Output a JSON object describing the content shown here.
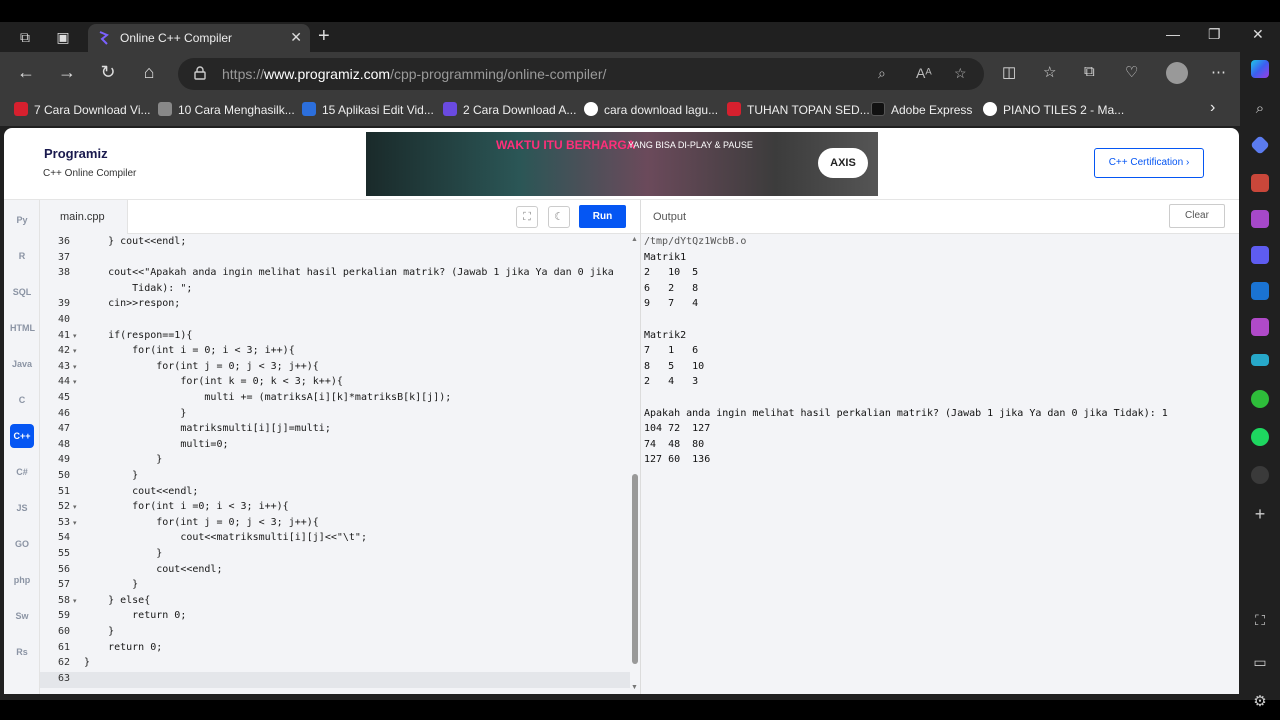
{
  "browser": {
    "tab_title": "Online C++ Compiler",
    "url_prefix": "https://",
    "url_domain": "www.programiz.com",
    "url_path": "/cpp-programming/online-compiler/",
    "bookmarks": [
      {
        "label": "7 Cara Download Vi...",
        "color": "#d6202e"
      },
      {
        "label": "10 Cara Menghasilk...",
        "color": "#666666"
      },
      {
        "label": "15 Aplikasi Edit Vid...",
        "color": "#2c6fdc"
      },
      {
        "label": "2 Cara Download A...",
        "color": "#6a4ae0"
      },
      {
        "label": "cara download lagu...",
        "color": "#ffffff"
      },
      {
        "label": "TUHAN TOPAN SED...",
        "color": "#d6202e"
      },
      {
        "label": "Adobe Express",
        "color": "#111111"
      },
      {
        "label": "PIANO TILES 2 - Ma...",
        "color": "#ffffff"
      }
    ]
  },
  "header": {
    "logo": "Programiz",
    "subtitle": "C++ Online Compiler",
    "ad_text": "WAKTU ITU BERHARGA",
    "ad_text2": "YANG BISA DI-PLAY & PAUSE",
    "ad_brand": "AXIS",
    "cert_button": "C++ Certification ›"
  },
  "languages": [
    "Py",
    "R",
    "SQL",
    "HTML",
    "Java",
    "C",
    "C++",
    "C#",
    "JS",
    "GO",
    "php",
    "Sw",
    "Rs"
  ],
  "editor": {
    "filename": "main.cpp",
    "run_label": "Run",
    "lines": [
      {
        "n": "36",
        "f": "",
        "t": "    } cout<<endl;"
      },
      {
        "n": "37",
        "f": "",
        "t": ""
      },
      {
        "n": "38",
        "f": "",
        "t": "    cout<<\"Apakah anda ingin melihat hasil perkalian matrik? (Jawab 1 jika Ya dan 0 jika"
      },
      {
        "n": "",
        "f": "",
        "t": "        Tidak): \";"
      },
      {
        "n": "39",
        "f": "",
        "t": "    cin>>respon;"
      },
      {
        "n": "40",
        "f": "",
        "t": ""
      },
      {
        "n": "41",
        "f": "▾",
        "t": "    if(respon==1){"
      },
      {
        "n": "42",
        "f": "▾",
        "t": "        for(int i = 0; i < 3; i++){"
      },
      {
        "n": "43",
        "f": "▾",
        "t": "            for(int j = 0; j < 3; j++){"
      },
      {
        "n": "44",
        "f": "▾",
        "t": "                for(int k = 0; k < 3; k++){"
      },
      {
        "n": "45",
        "f": "",
        "t": "                    multi += (matriksA[i][k]*matriksB[k][j]);"
      },
      {
        "n": "46",
        "f": "",
        "t": "                }"
      },
      {
        "n": "47",
        "f": "",
        "t": "                matriksmulti[i][j]=multi;"
      },
      {
        "n": "48",
        "f": "",
        "t": "                multi=0;"
      },
      {
        "n": "49",
        "f": "",
        "t": "            }"
      },
      {
        "n": "50",
        "f": "",
        "t": "        }"
      },
      {
        "n": "51",
        "f": "",
        "t": "        cout<<endl;"
      },
      {
        "n": "52",
        "f": "▾",
        "t": "        for(int i =0; i < 3; i++){"
      },
      {
        "n": "53",
        "f": "▾",
        "t": "            for(int j = 0; j < 3; j++){"
      },
      {
        "n": "54",
        "f": "",
        "t": "                cout<<matriksmulti[i][j]<<\"\\t\";"
      },
      {
        "n": "55",
        "f": "",
        "t": "            }"
      },
      {
        "n": "56",
        "f": "",
        "t": "            cout<<endl;"
      },
      {
        "n": "57",
        "f": "",
        "t": "        }"
      },
      {
        "n": "58",
        "f": "▾",
        "t": "    } else{"
      },
      {
        "n": "59",
        "f": "",
        "t": "        return 0;"
      },
      {
        "n": "60",
        "f": "",
        "t": "    }"
      },
      {
        "n": "61",
        "f": "",
        "t": "    return 0;"
      },
      {
        "n": "62",
        "f": "",
        "t": "}"
      },
      {
        "n": "63",
        "f": "",
        "t": ""
      }
    ]
  },
  "output": {
    "label": "Output",
    "clear_label": "Clear",
    "lines": [
      "/tmp/dYtQz1WcbB.o",
      "Matrik1",
      "2   10  5",
      "6   2   8",
      "9   7   4",
      "",
      "Matrik2",
      "7   1   6",
      "8   5   10",
      "2   4   3",
      "",
      "Apakah anda ingin melihat hasil perkalian matrik? (Jawab 1 jika Ya dan 0 jika Tidak): 1",
      "104 72  127",
      "74  48  80",
      "127 60  136"
    ]
  }
}
